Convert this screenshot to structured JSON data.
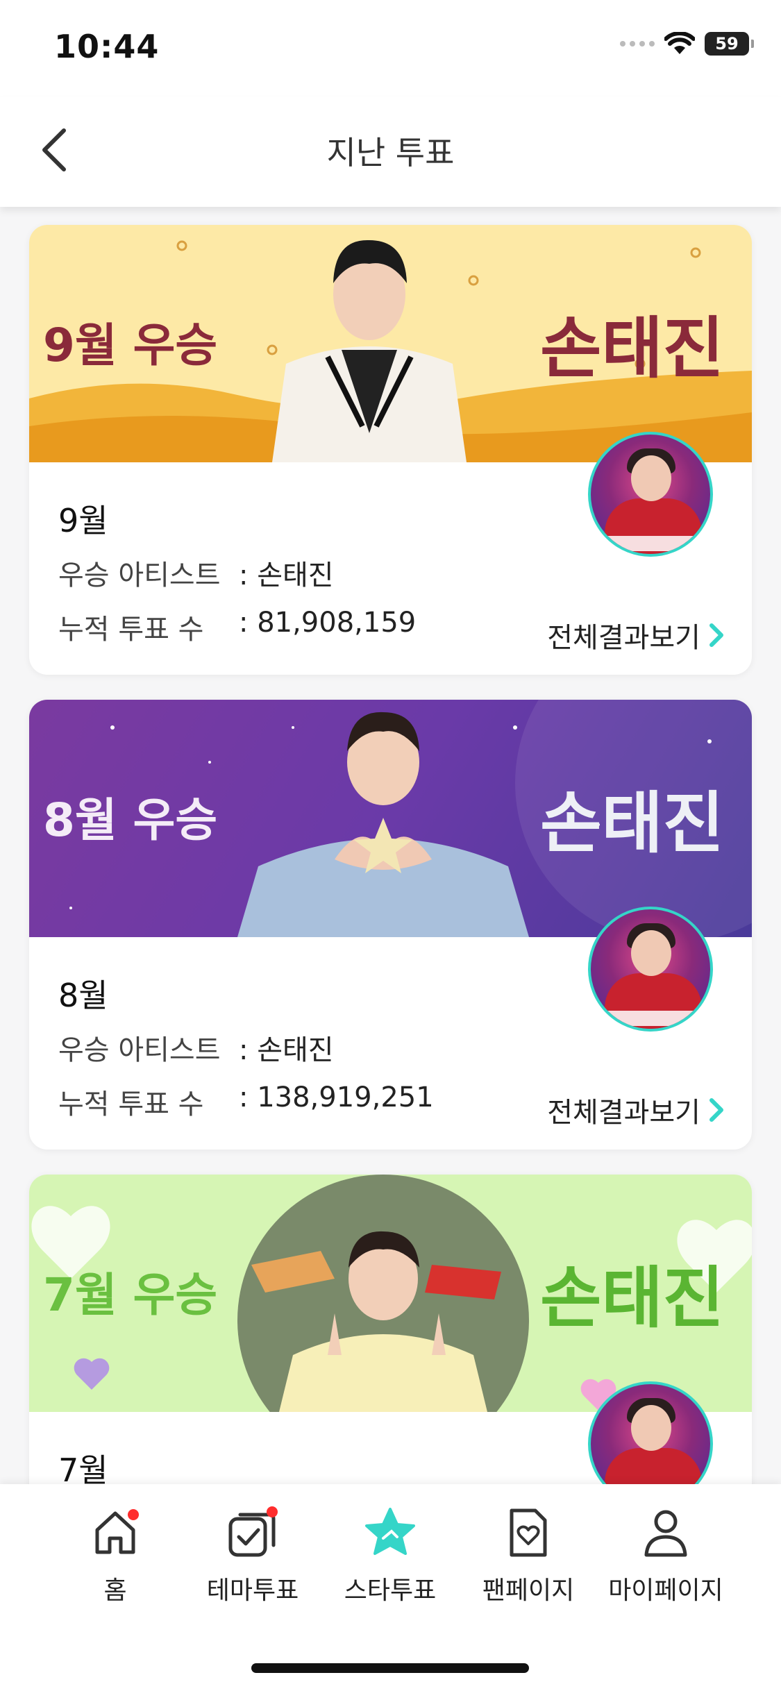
{
  "status": {
    "time": "10:44",
    "battery": "59"
  },
  "header": {
    "title": "지난 투표"
  },
  "cards": [
    {
      "banner_left": "9월 우승",
      "banner_right": "손태진",
      "month": "9월",
      "winner_label": "우승 아티스트",
      "winner_value": ": 손태진",
      "votes_label": "누적 투표 수",
      "votes_value": ": 81,908,159",
      "more_label": "전체결과보기"
    },
    {
      "banner_left": "8월 우승",
      "banner_right": "손태진",
      "month": "8월",
      "winner_label": "우승 아티스트",
      "winner_value": ": 손태진",
      "votes_label": "누적 투표 수",
      "votes_value": ": 138,919,251",
      "more_label": "전체결과보기"
    },
    {
      "banner_left": "7월 우승",
      "banner_right": "손태진",
      "month": "7월"
    }
  ],
  "tabs": [
    {
      "label": "홈",
      "icon": "home-icon",
      "badge": true
    },
    {
      "label": "테마투표",
      "icon": "theme-vote-icon",
      "badge": true
    },
    {
      "label": "스타투표",
      "icon": "star-vote-icon",
      "active": true
    },
    {
      "label": "팬페이지",
      "icon": "fan-page-icon"
    },
    {
      "label": "마이페이지",
      "icon": "my-page-icon"
    }
  ],
  "colors": {
    "accent": "#35d5c8",
    "badge": "#ff2d2d"
  }
}
